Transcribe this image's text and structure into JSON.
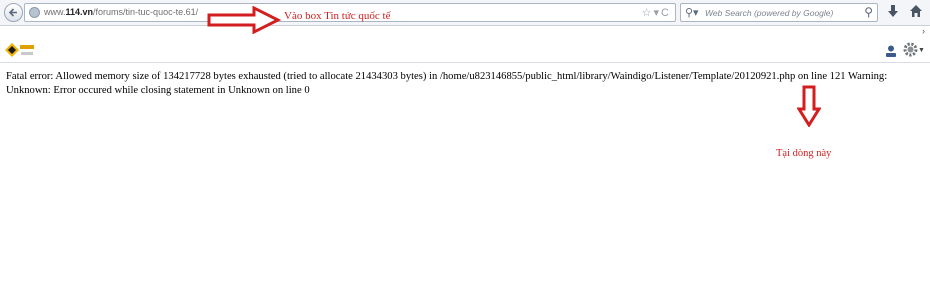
{
  "browser": {
    "url_prefix": "www.",
    "url_domain": "114.vn",
    "url_path": "/forums/tin-tuc-quoc-te.61/",
    "search_placeholder": "Web Search (powered by Google)"
  },
  "page": {
    "error_message": "Fatal error: Allowed memory size of 134217728 bytes exhausted (tried to allocate 21434303 bytes) in /home/u823146855/public_html/library/Waindigo/Listener/Template/20120921.php on line 121 Warning: Unknown: Error occured while closing statement in Unknown on line 0"
  },
  "annotations": {
    "top_label": "Vào box Tin tức quốc tế",
    "bottom_label": "Tại dòng này",
    "color": "#d21e1e"
  },
  "icons": [
    "back-icon",
    "globe-icon",
    "star-icon",
    "search-icon",
    "download-icon",
    "home-icon",
    "user-icon",
    "gear-icon"
  ]
}
